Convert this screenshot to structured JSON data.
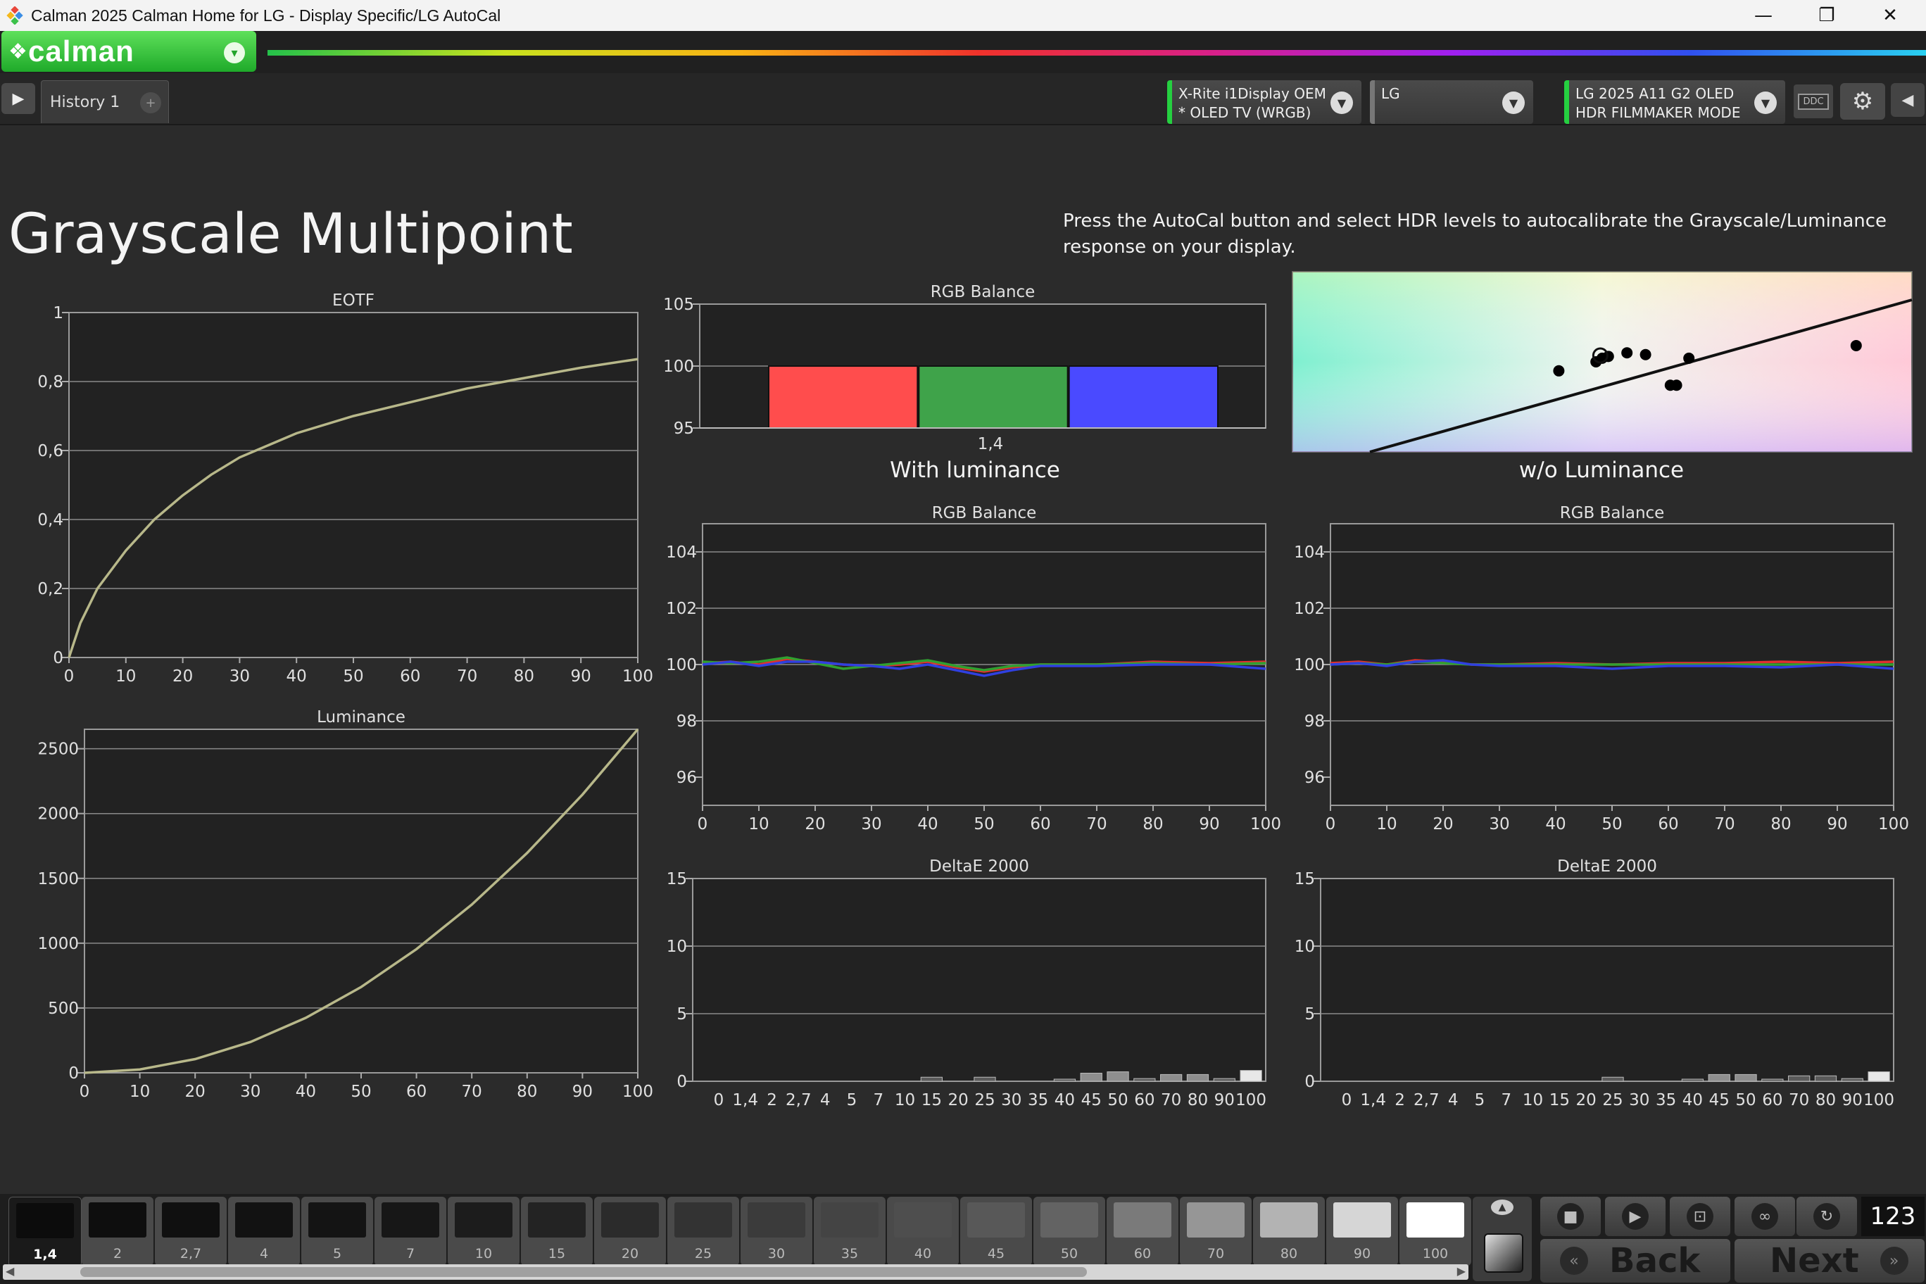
{
  "window": {
    "title": "Calman 2025 Calman Home for LG  - Display Specific/LG AutoCal",
    "minimize": "—",
    "maximize": "❐",
    "close": "✕"
  },
  "brand": {
    "logo_text": "calman",
    "dropdown_icon": "▾"
  },
  "tabs": {
    "back_arrow": "▶",
    "active_tab": "History 1",
    "add_tab": "+"
  },
  "devices": {
    "meter": {
      "line1": "X-Rite i1Display OEM",
      "line2": "* OLED TV (WRGB)",
      "status_color": "#25d040"
    },
    "source": {
      "line1": "LG",
      "line2": "",
      "status_color": "#777777"
    },
    "display": {
      "line1": "LG 2025 A11 G2 OLED",
      "line2": "HDR FILMMAKER MODE",
      "status_color": "#25d040"
    },
    "ddc_label": "DDC",
    "settings_icon": "gear-icon",
    "panel_arrow": "◀"
  },
  "page": {
    "title": "Grayscale Multipoint",
    "instructions": "Press the AutoCal button and select HDR levels to autocalibrate the Grayscale/Luminance response on your display.",
    "with_luminance_label": "With luminance",
    "without_luminance_label": "w/o Luminance"
  },
  "chart_data": [
    {
      "id": "eotf",
      "type": "line",
      "title": "EOTF",
      "xlim": [
        0,
        100
      ],
      "ylim": [
        0,
        1
      ],
      "x_ticks": [
        "0",
        "10",
        "20",
        "30",
        "40",
        "50",
        "60",
        "70",
        "80",
        "90",
        "100"
      ],
      "y_ticks": [
        "0",
        "0,2",
        "0,4",
        "0,6",
        "0,8",
        "1"
      ],
      "series": [
        {
          "color": "#b8b88a",
          "x": [
            0,
            2,
            5,
            10,
            15,
            20,
            25,
            30,
            40,
            50,
            60,
            70,
            80,
            90,
            100
          ],
          "values": [
            0,
            0.1,
            0.2,
            0.31,
            0.4,
            0.47,
            0.53,
            0.58,
            0.65,
            0.7,
            0.74,
            0.78,
            0.81,
            0.84,
            0.865
          ]
        }
      ]
    },
    {
      "id": "luminance",
      "type": "line",
      "title": "Luminance",
      "xlim": [
        0,
        100
      ],
      "ylim": [
        0,
        2650
      ],
      "x_ticks": [
        "0",
        "10",
        "20",
        "30",
        "40",
        "50",
        "60",
        "70",
        "80",
        "90",
        "100"
      ],
      "y_ticks": [
        "0",
        "500",
        "1000",
        "1500",
        "2000",
        "2500"
      ],
      "series": [
        {
          "color": "#b8b88a",
          "x": [
            0,
            10,
            20,
            30,
            40,
            50,
            60,
            70,
            80,
            90,
            100
          ],
          "values": [
            0,
            26,
            106,
            238,
            424,
            662,
            954,
            1298,
            1696,
            2146,
            2650
          ]
        }
      ]
    },
    {
      "id": "rgb-balance-single",
      "type": "bar",
      "title": "RGB Balance",
      "ylim": [
        95,
        105
      ],
      "y_ticks": [
        "95",
        "100",
        "105"
      ],
      "categories": [
        "1,4"
      ],
      "series": [
        {
          "color": "#ff4d4d",
          "values": [
            100
          ]
        },
        {
          "color": "#3fa34a",
          "values": [
            100
          ]
        },
        {
          "color": "#4a4aff",
          "values": [
            100
          ]
        }
      ]
    },
    {
      "id": "rgb-balance-with",
      "type": "line",
      "title": "RGB Balance",
      "xlim": [
        0,
        100
      ],
      "ylim": [
        95,
        105
      ],
      "x_ticks": [
        "0",
        "10",
        "20",
        "30",
        "40",
        "50",
        "60",
        "70",
        "80",
        "90",
        "100"
      ],
      "y_ticks": [
        "96",
        "98",
        "100",
        "102",
        "104"
      ],
      "series": [
        {
          "color": "#e03030",
          "x": [
            0,
            5,
            10,
            15,
            20,
            25,
            30,
            35,
            40,
            45,
            50,
            55,
            60,
            70,
            80,
            90,
            100
          ],
          "values": [
            100.05,
            100.1,
            100.0,
            100.2,
            100.1,
            100.0,
            99.95,
            100.0,
            100.1,
            99.9,
            99.75,
            99.9,
            100.0,
            100.0,
            100.1,
            100.05,
            100.1
          ]
        },
        {
          "color": "#30a030",
          "x": [
            0,
            5,
            10,
            15,
            20,
            25,
            30,
            35,
            40,
            45,
            50,
            55,
            60,
            70,
            80,
            90,
            100
          ],
          "values": [
            100.1,
            100.05,
            100.1,
            100.25,
            100.05,
            99.85,
            99.95,
            100.05,
            100.15,
            99.95,
            99.8,
            99.95,
            100.0,
            100.0,
            100.05,
            100.0,
            100.05
          ]
        },
        {
          "color": "#3040e0",
          "x": [
            0,
            5,
            10,
            15,
            20,
            25,
            30,
            35,
            40,
            45,
            50,
            55,
            60,
            70,
            80,
            90,
            100
          ],
          "values": [
            100.0,
            100.1,
            99.95,
            100.1,
            100.1,
            100.0,
            99.95,
            99.85,
            100.0,
            99.8,
            99.6,
            99.8,
            99.95,
            99.95,
            100.0,
            100.0,
            99.85
          ]
        }
      ]
    },
    {
      "id": "rgb-balance-without",
      "type": "line",
      "title": "RGB Balance",
      "xlim": [
        0,
        100
      ],
      "ylim": [
        95,
        105
      ],
      "x_ticks": [
        "0",
        "10",
        "20",
        "30",
        "40",
        "50",
        "60",
        "70",
        "80",
        "90",
        "100"
      ],
      "y_ticks": [
        "96",
        "98",
        "100",
        "102",
        "104"
      ],
      "series": [
        {
          "color": "#e03030",
          "x": [
            0,
            5,
            10,
            15,
            20,
            25,
            30,
            40,
            50,
            60,
            70,
            80,
            90,
            100
          ],
          "values": [
            100.05,
            100.1,
            100.0,
            100.15,
            100.1,
            100.0,
            100.0,
            100.05,
            100.0,
            100.05,
            100.05,
            100.1,
            100.05,
            100.1
          ]
        },
        {
          "color": "#30a030",
          "x": [
            0,
            5,
            10,
            15,
            20,
            25,
            30,
            40,
            50,
            60,
            70,
            80,
            90,
            100
          ],
          "values": [
            100.0,
            100.05,
            100.0,
            100.1,
            100.05,
            100.0,
            100.0,
            100.0,
            100.0,
            100.0,
            100.0,
            100.0,
            100.0,
            100.0
          ]
        },
        {
          "color": "#3040e0",
          "x": [
            0,
            5,
            10,
            15,
            20,
            25,
            30,
            40,
            50,
            60,
            70,
            80,
            90,
            100
          ],
          "values": [
            100.0,
            100.05,
            99.95,
            100.1,
            100.15,
            100.0,
            99.95,
            99.95,
            99.85,
            99.95,
            99.95,
            99.9,
            100.0,
            99.85
          ]
        }
      ]
    },
    {
      "id": "deltae-with",
      "type": "bar",
      "title": "DeltaE 2000",
      "ylim": [
        0,
        15
      ],
      "y_ticks": [
        "0",
        "5",
        "10",
        "15"
      ],
      "categories": [
        "0",
        "1,4",
        "2",
        "2,7",
        "4",
        "5",
        "7",
        "10",
        "15",
        "20",
        "25",
        "30",
        "35",
        "40",
        "45",
        "50",
        "60",
        "70",
        "80",
        "90",
        "100"
      ],
      "series": [
        {
          "color": "#8a8a8a",
          "values": [
            0,
            0,
            0,
            0,
            0,
            0,
            0,
            0,
            0.3,
            0,
            0.3,
            0,
            0,
            0.1,
            0.6,
            0.7,
            0.2,
            0.5,
            0.5,
            0.2,
            0.8
          ]
        }
      ]
    },
    {
      "id": "deltae-without",
      "type": "bar",
      "title": "DeltaE 2000",
      "ylim": [
        0,
        15
      ],
      "y_ticks": [
        "0",
        "5",
        "10",
        "15"
      ],
      "categories": [
        "0",
        "1,4",
        "2",
        "2,7",
        "4",
        "5",
        "7",
        "10",
        "15",
        "20",
        "25",
        "30",
        "35",
        "40",
        "45",
        "50",
        "60",
        "70",
        "80",
        "90",
        "100"
      ],
      "series": [
        {
          "color": "#8a8a8a",
          "values": [
            0,
            0,
            0,
            0,
            0,
            0,
            0,
            0,
            0,
            0,
            0.3,
            0,
            0,
            0.1,
            0.5,
            0.5,
            0.1,
            0.4,
            0.4,
            0.2,
            0.7
          ]
        }
      ]
    },
    {
      "id": "white-point-target",
      "type": "scatter",
      "title": "",
      "series": [
        {
          "color": "#000000",
          "x": [
            0.43,
            0.49,
            0.5,
            0.51,
            0.54,
            0.57,
            0.61,
            0.62,
            0.64,
            0.91
          ],
          "values": [
            0.45,
            0.5,
            0.52,
            0.53,
            0.55,
            0.54,
            0.37,
            0.37,
            0.52,
            0.59
          ]
        }
      ]
    }
  ],
  "patches": [
    {
      "label": "1,4",
      "color": "#0c0c0c",
      "selected": true
    },
    {
      "label": "2",
      "color": "#0e0e0e"
    },
    {
      "label": "2,7",
      "color": "#101010"
    },
    {
      "label": "4",
      "color": "#121212"
    },
    {
      "label": "5",
      "color": "#141414"
    },
    {
      "label": "7",
      "color": "#171717"
    },
    {
      "label": "10",
      "color": "#1c1c1c"
    },
    {
      "label": "15",
      "color": "#232323"
    },
    {
      "label": "20",
      "color": "#2b2b2b"
    },
    {
      "label": "25",
      "color": "#333333"
    },
    {
      "label": "30",
      "color": "#3b3b3b"
    },
    {
      "label": "35",
      "color": "#444444"
    },
    {
      "label": "40",
      "color": "#4e4e4e"
    },
    {
      "label": "45",
      "color": "#585858"
    },
    {
      "label": "50",
      "color": "#636363"
    },
    {
      "label": "60",
      "color": "#7a7a7a"
    },
    {
      "label": "70",
      "color": "#969696"
    },
    {
      "label": "80",
      "color": "#b3b3b3"
    },
    {
      "label": "90",
      "color": "#d6d6d6"
    },
    {
      "label": "100",
      "color": "#ffffff"
    }
  ],
  "controls": {
    "stop_icon": "■",
    "play_icon": "▶",
    "save_icon": "⊡",
    "loop_icon": "∞",
    "refresh_icon": "↻",
    "counter": "123",
    "back_label": "Back",
    "next_label": "Next",
    "back_icon": "«",
    "next_icon": "»",
    "scroll_up": "▲",
    "scroll_left": "◀",
    "scroll_right": "▶"
  }
}
